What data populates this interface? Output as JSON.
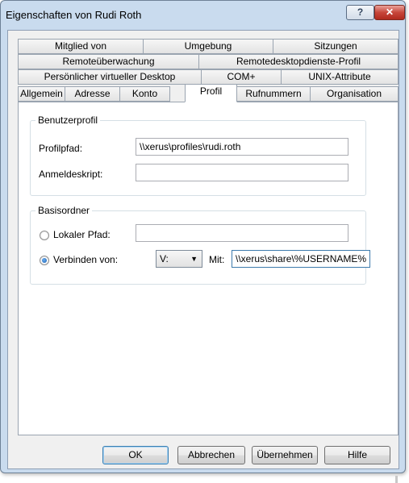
{
  "window": {
    "title": "Eigenschaften von Rudi Roth",
    "help_label": "?",
    "close_label": "✕"
  },
  "tabs": {
    "row1": [
      "Mitglied von",
      "Umgebung",
      "Sitzungen"
    ],
    "row2": [
      "Remoteüberwachung",
      "Remotedesktopdienste-Profil"
    ],
    "row3": [
      "Persönlicher virtueller Desktop",
      "COM+",
      "UNIX-Attribute"
    ],
    "row4": [
      "Allgemein",
      "Adresse",
      "Konto",
      "Profil",
      "Rufnummern",
      "Organisation"
    ],
    "active": "Profil"
  },
  "user_profile": {
    "title": "Benutzerprofil",
    "profile_path_label": "Profilpfad:",
    "profile_path_value": "\\\\xerus\\profiles\\rudi.roth",
    "logon_script_label": "Anmeldeskript:",
    "logon_script_value": ""
  },
  "home_folder": {
    "title": "Basisordner",
    "local_path_label": "Lokaler Pfad:",
    "local_path_value": "",
    "connect_label": "Verbinden von:",
    "drive_value": "V:",
    "with_label": "Mit:",
    "with_value": "\\\\xerus\\share\\%USERNAME%",
    "selected": "connect"
  },
  "buttons": {
    "ok": "OK",
    "cancel": "Abbrechen",
    "apply": "Übernehmen",
    "help": "Hilfe"
  }
}
